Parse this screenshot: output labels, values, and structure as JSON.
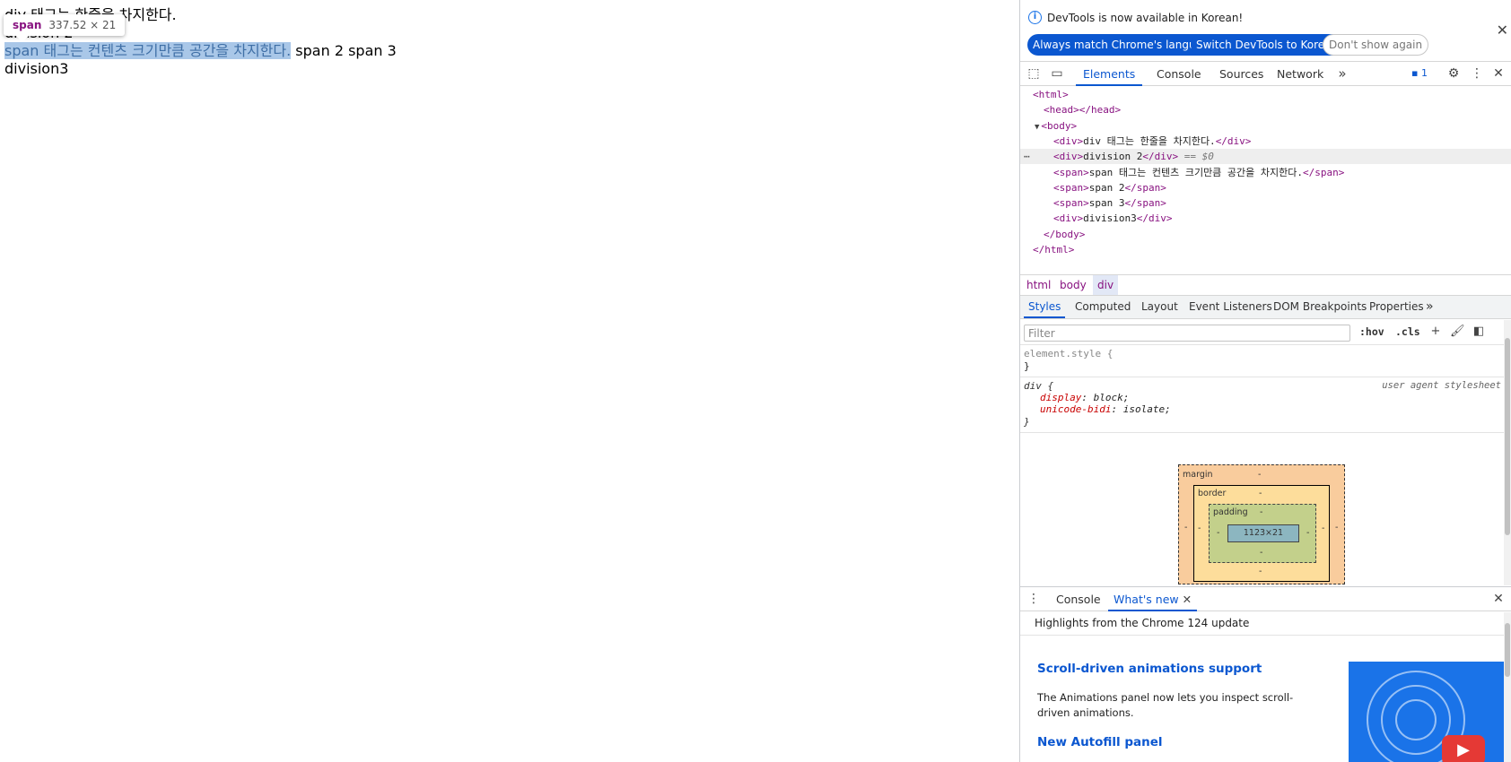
{
  "page": {
    "line1": "div 태그는 한줄을 차지한다.",
    "line2": "division 2",
    "span1": "span 태그는 컨텐츠 크기만큼 공간을 차지한다.",
    "span_rest": " span 2 span 3",
    "line4": "division3",
    "tooltip": {
      "tag": "span",
      "dims": "337.52 × 21"
    }
  },
  "devtools": {
    "infobar": {
      "text": "DevTools is now available in Korean!",
      "btn_match": "Always match Chrome's language",
      "btn_switch": "Switch DevTools to Korean",
      "btn_dismiss": "Don't show again"
    },
    "tabs": [
      "Elements",
      "Console",
      "Sources",
      "Network"
    ],
    "issues_count": "1",
    "dom": {
      "l1": "<html>",
      "l2": "<head></head>",
      "l3": "<body>",
      "l4_open": "<div>",
      "l4_text": "div 태그는 한줄을 차지한다.",
      "l4_close": "</div>",
      "l5_open": "<div>",
      "l5_text": "division 2",
      "l5_close": "</div>",
      "l5_eq": " == $0",
      "l6_open": "<span>",
      "l6_text": "span 태그는 컨텐츠 크기만큼 공간을 차지한다.",
      "l6_close": "</span>",
      "l7_open": "<span>",
      "l7_text": "span 2",
      "l7_close": "</span>",
      "l8_open": "<span>",
      "l8_text": "span 3",
      "l8_close": "</span>",
      "l9_open": "<div>",
      "l9_text": "division3",
      "l9_close": "</div>",
      "l10": "</body>",
      "l11": "</html>"
    },
    "breadcrumbs": [
      "html",
      "body",
      "div"
    ],
    "subtabs": [
      "Styles",
      "Computed",
      "Layout",
      "Event Listeners",
      "DOM Breakpoints",
      "Properties"
    ],
    "filter_placeholder": "Filter",
    "hov": ":hov",
    "cls": ".cls",
    "styles": {
      "element_style": "element.style {",
      "close": "}",
      "div_selector": "div {",
      "ua_label": "user agent stylesheet",
      "p1_name": "display",
      "p1_value": "block;",
      "p2_name": "unicode-bidi",
      "p2_value": "isolate;"
    },
    "boxmodel": {
      "margin": "margin",
      "border": "border",
      "padding": "padding",
      "content": "1123×21",
      "dash": "-"
    },
    "drawer": {
      "tabs": [
        "Console",
        "What's new"
      ],
      "subtitle": "Highlights from the Chrome 124 update",
      "h1": "Scroll-driven animations support",
      "p1": "The Animations panel now lets you inspect scroll-driven animations.",
      "h2": "New Autofill panel"
    }
  }
}
